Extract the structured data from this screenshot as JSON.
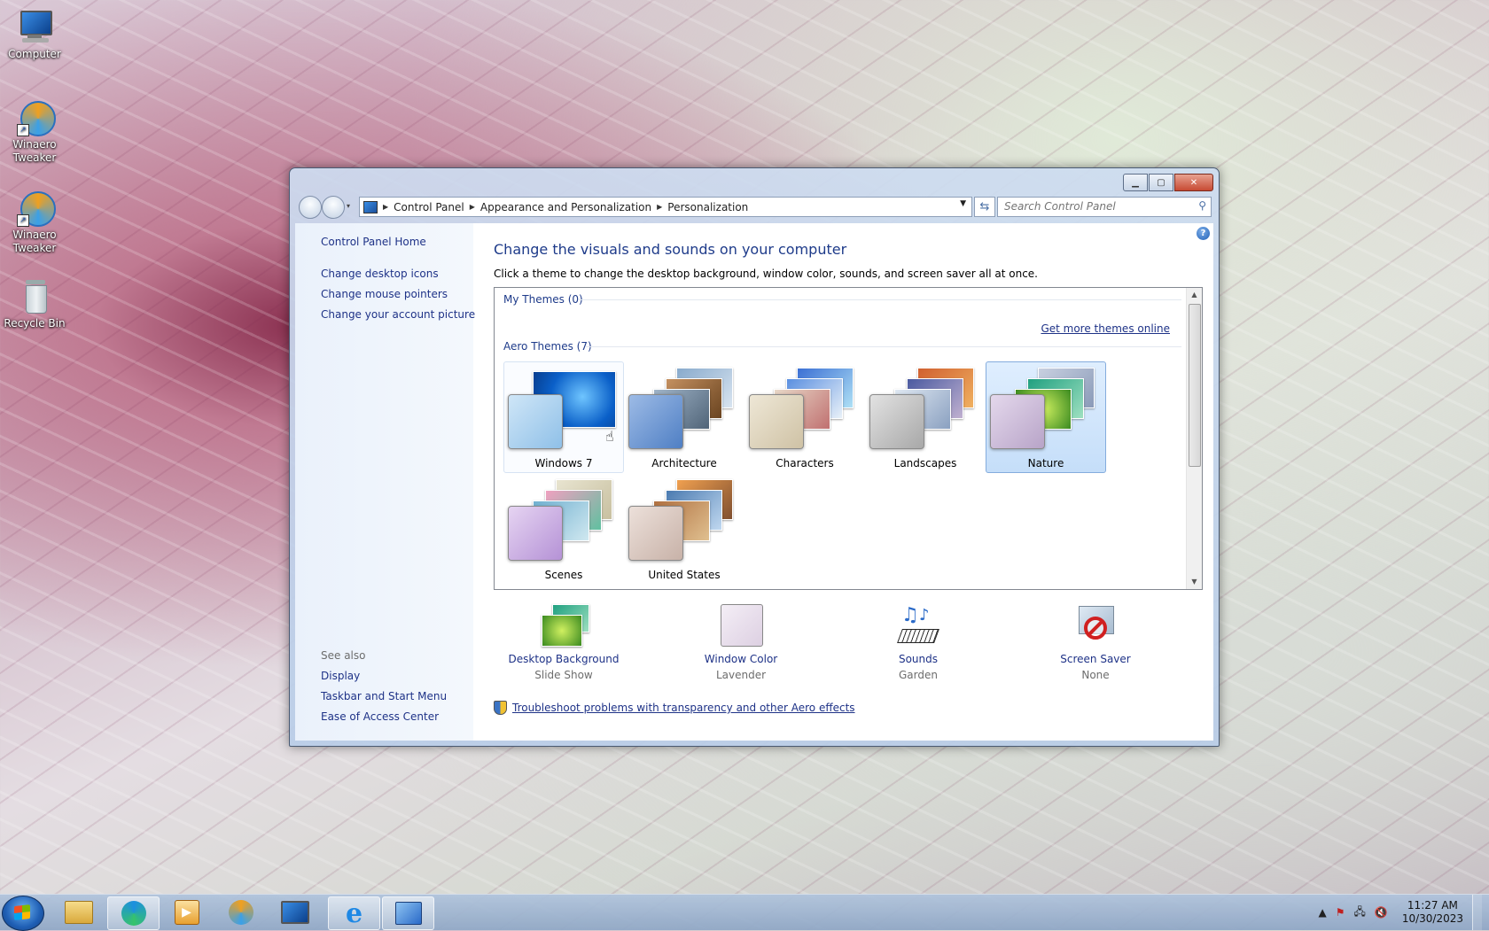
{
  "desktop": {
    "icons": [
      {
        "label": "Computer"
      },
      {
        "label": "Winaero Tweaker"
      },
      {
        "label": "Winaero Tweaker"
      },
      {
        "label": "Recycle Bin"
      }
    ]
  },
  "window": {
    "breadcrumb": [
      "Control Panel",
      "Appearance and Personalization",
      "Personalization"
    ],
    "search_placeholder": "Search Control Panel"
  },
  "sidebar": {
    "home": "Control Panel Home",
    "links": [
      "Change desktop icons",
      "Change mouse pointers",
      "Change your account picture"
    ],
    "see_also_label": "See also",
    "see_also": [
      "Display",
      "Taskbar and Start Menu",
      "Ease of Access Center"
    ]
  },
  "main": {
    "title": "Change the visuals and sounds on your computer",
    "subtitle": "Click a theme to change the desktop background, window color, sounds, and screen saver all at once.",
    "my_themes_label": "My Themes (0)",
    "get_more": "Get more themes online",
    "aero_themes_label": "Aero Themes (7)",
    "themes": [
      {
        "name": "Windows 7",
        "state": "hover"
      },
      {
        "name": "Architecture",
        "state": "normal"
      },
      {
        "name": "Characters",
        "state": "normal"
      },
      {
        "name": "Landscapes",
        "state": "normal"
      },
      {
        "name": "Nature",
        "state": "selected"
      },
      {
        "name": "Scenes",
        "state": "normal"
      },
      {
        "name": "United States",
        "state": "normal"
      }
    ],
    "options": [
      {
        "label": "Desktop Background",
        "value": "Slide Show"
      },
      {
        "label": "Window Color",
        "value": "Lavender"
      },
      {
        "label": "Sounds",
        "value": "Garden"
      },
      {
        "label": "Screen Saver",
        "value": "None"
      }
    ],
    "troubleshoot": "Troubleshoot problems with transparency and other Aero effects"
  },
  "taskbar": {
    "time": "11:27 AM",
    "date": "10/30/2023"
  }
}
